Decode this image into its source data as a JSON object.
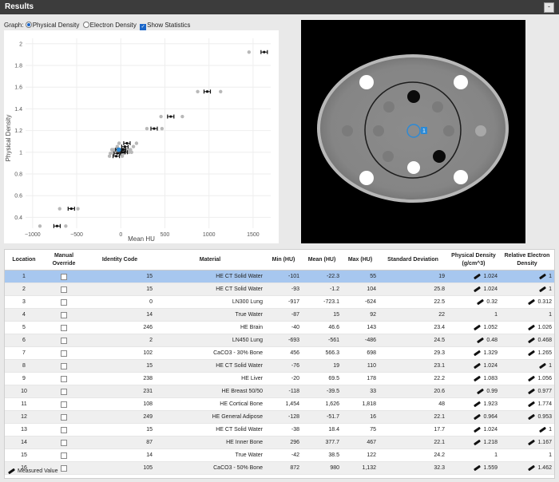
{
  "header": {
    "title": "Results",
    "collapse_label": "-"
  },
  "graph_options": {
    "label": "Graph:",
    "physical_density": "Physical Density",
    "electron_density": "Electron Density",
    "show_statistics": "Show Statistics"
  },
  "chart_data": {
    "type": "scatter",
    "xlabel": "Mean HU",
    "ylabel": "Physical Density",
    "xlim": [
      -1080,
      1700
    ],
    "ylim": [
      0.3,
      2.05
    ],
    "x_ticks": [
      -1000,
      -500,
      0,
      500,
      1000,
      1500
    ],
    "x_tick_labels": [
      "−1000",
      "−500",
      "0",
      "500",
      "1000",
      "1500"
    ],
    "y_ticks": [
      0.4,
      0.6,
      0.8,
      1,
      1.2,
      1.4,
      1.6,
      1.8,
      2
    ],
    "y_tick_labels": [
      "0.4",
      "0.6",
      "0.8",
      "1",
      "1.2",
      "1.4",
      "1.6",
      "1.8",
      "2"
    ],
    "grid": true,
    "selected_point": {
      "x": -22.3,
      "y": 1.024
    },
    "series": [
      {
        "x": [
          -22.3,
          -1.2,
          -723.1,
          15,
          46.6,
          -561,
          566.3,
          19,
          69.5,
          -39.5,
          1626,
          -51.7,
          18.4,
          377.7,
          38.5,
          980
        ],
        "y": [
          1.024,
          1.024,
          0.32,
          1,
          1.052,
          0.48,
          1.329,
          1.024,
          1.083,
          0.99,
          1.923,
          0.964,
          1.024,
          1.218,
          1,
          1.559
        ],
        "min": [
          -101,
          -93,
          -917,
          -87,
          -40,
          -693,
          456,
          -76,
          -20,
          -118,
          1454,
          -128,
          -38,
          296,
          -42,
          872
        ],
        "max": [
          55,
          104,
          -624,
          92,
          143,
          -486,
          698,
          110,
          178,
          33,
          1818,
          16,
          75,
          467,
          122,
          1132
        ]
      }
    ]
  },
  "table": {
    "columns": [
      "Location",
      "Manual Override",
      "Identity Code",
      "Material",
      "Min (HU)",
      "Mean (HU)",
      "Max (HU)",
      "Standard Deviation",
      "Physical Density (g/cm^3)",
      "Relative Electron Density"
    ],
    "rows": [
      {
        "location": "1",
        "identity": "15",
        "material": "HE CT Solid Water",
        "min": "-101",
        "mean": "-22.3",
        "max": "55",
        "sd": "19",
        "pd": "1.024",
        "pd_measured": true,
        "ed": "1",
        "ed_measured": true
      },
      {
        "location": "2",
        "identity": "15",
        "material": "HE CT Solid Water",
        "min": "-93",
        "mean": "-1.2",
        "max": "104",
        "sd": "25.8",
        "pd": "1.024",
        "pd_measured": true,
        "ed": "1",
        "ed_measured": true
      },
      {
        "location": "3",
        "identity": "0",
        "material": "LN300 Lung",
        "min": "-917",
        "mean": "-723.1",
        "max": "-624",
        "sd": "22.5",
        "pd": "0.32",
        "pd_measured": true,
        "ed": "0.312",
        "ed_measured": true
      },
      {
        "location": "4",
        "identity": "14",
        "material": "True Water",
        "min": "-87",
        "mean": "15",
        "max": "92",
        "sd": "22",
        "pd": "1",
        "pd_measured": false,
        "ed": "1",
        "ed_measured": false
      },
      {
        "location": "5",
        "identity": "246",
        "material": "HE Brain",
        "min": "-40",
        "mean": "46.6",
        "max": "143",
        "sd": "23.4",
        "pd": "1.052",
        "pd_measured": true,
        "ed": "1.026",
        "ed_measured": true
      },
      {
        "location": "6",
        "identity": "2",
        "material": "LN450 Lung",
        "min": "-693",
        "mean": "-561",
        "max": "-486",
        "sd": "24.5",
        "pd": "0.48",
        "pd_measured": true,
        "ed": "0.468",
        "ed_measured": true
      },
      {
        "location": "7",
        "identity": "102",
        "material": "CaCO3 - 30% Bone",
        "min": "456",
        "mean": "566.3",
        "max": "698",
        "sd": "29.3",
        "pd": "1.329",
        "pd_measured": true,
        "ed": "1.265",
        "ed_measured": true
      },
      {
        "location": "8",
        "identity": "15",
        "material": "HE CT Solid Water",
        "min": "-76",
        "mean": "19",
        "max": "110",
        "sd": "23.1",
        "pd": "1.024",
        "pd_measured": true,
        "ed": "1",
        "ed_measured": true
      },
      {
        "location": "9",
        "identity": "238",
        "material": "HE Liver",
        "min": "-20",
        "mean": "69.5",
        "max": "178",
        "sd": "22.2",
        "pd": "1.083",
        "pd_measured": true,
        "ed": "1.056",
        "ed_measured": true
      },
      {
        "location": "10",
        "identity": "231",
        "material": "HE Breast 50/50",
        "min": "-118",
        "mean": "-39.5",
        "max": "33",
        "sd": "20.6",
        "pd": "0.99",
        "pd_measured": true,
        "ed": "0.977",
        "ed_measured": true
      },
      {
        "location": "11",
        "identity": "108",
        "material": "HE Cortical Bone",
        "min": "1,454",
        "mean": "1,626",
        "max": "1,818",
        "sd": "48",
        "pd": "1.923",
        "pd_measured": true,
        "ed": "1.774",
        "ed_measured": true
      },
      {
        "location": "12",
        "identity": "249",
        "material": "HE General Adipose",
        "min": "-128",
        "mean": "-51.7",
        "max": "16",
        "sd": "22.1",
        "pd": "0.964",
        "pd_measured": true,
        "ed": "0.953",
        "ed_measured": true
      },
      {
        "location": "13",
        "identity": "15",
        "material": "HE CT Solid Water",
        "min": "-38",
        "mean": "18.4",
        "max": "75",
        "sd": "17.7",
        "pd": "1.024",
        "pd_measured": true,
        "ed": "1",
        "ed_measured": true
      },
      {
        "location": "14",
        "identity": "87",
        "material": "HE Inner Bone",
        "min": "296",
        "mean": "377.7",
        "max": "467",
        "sd": "22.1",
        "pd": "1.218",
        "pd_measured": true,
        "ed": "1.167",
        "ed_measured": true
      },
      {
        "location": "15",
        "identity": "14",
        "material": "True Water",
        "min": "-42",
        "mean": "38.5",
        "max": "122",
        "sd": "24.2",
        "pd": "1",
        "pd_measured": false,
        "ed": "1",
        "ed_measured": false
      },
      {
        "location": "16",
        "identity": "105",
        "material": "CaCO3 - 50% Bone",
        "min": "872",
        "mean": "980",
        "max": "1,132",
        "sd": "32.3",
        "pd": "1.559",
        "pd_measured": true,
        "ed": "1.462",
        "ed_measured": true
      }
    ],
    "selected_row": 0,
    "legend_label": "Measured Value"
  },
  "ct_image": {
    "selected_label": "1"
  }
}
